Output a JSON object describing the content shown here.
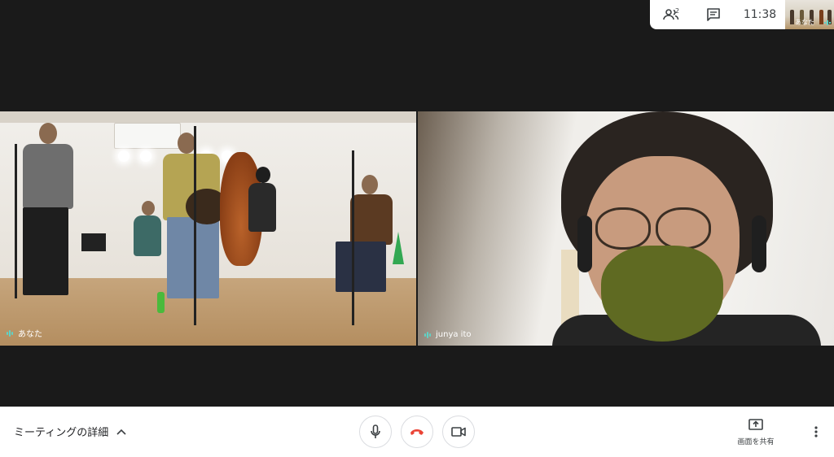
{
  "top_bar": {
    "participants_count": "2",
    "participants_icon": "people-icon",
    "chat_icon": "chat-icon",
    "clock": "11:38",
    "self_view_label": "あなた"
  },
  "tiles": [
    {
      "name": "あなた",
      "scene": "band-rehearsal-room"
    },
    {
      "name": "junya ito",
      "scene": "webcam-closeup"
    }
  ],
  "bottom_bar": {
    "meeting_details_label": "ミーティングの詳細",
    "expand_icon": "chevron-up-icon",
    "mic_icon": "microphone-icon",
    "hangup_icon": "hang-up-icon",
    "camera_icon": "video-camera-icon",
    "share_label": "画面を共有",
    "share_icon": "present-screen-icon",
    "more_icon": "more-vert-icon"
  },
  "colors": {
    "hangup_red": "#ea4335",
    "audio_indicator": "#5fd3c6",
    "background": "#1a1a1a"
  }
}
